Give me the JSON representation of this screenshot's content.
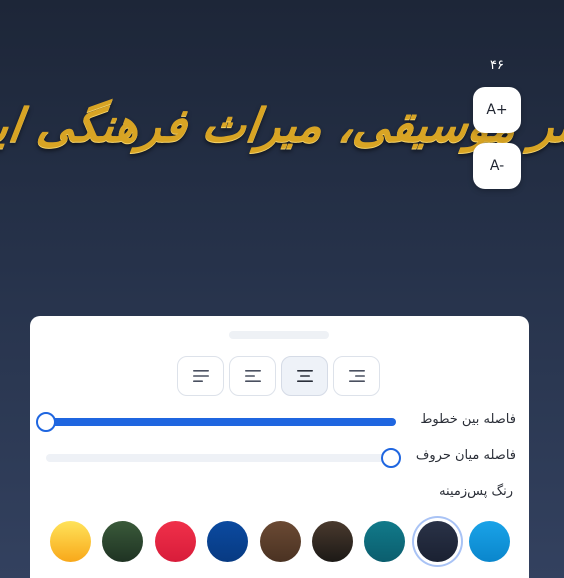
{
  "preview": {
    "text": "هنر موسیقی، میراث فرهنگی ایران",
    "color": "#d8a424"
  },
  "font_size": {
    "value": "۴۶",
    "increase_label": "A+",
    "decrease_label": "A-"
  },
  "panel": {
    "alignment": {
      "options": [
        {
          "name": "align-right",
          "icon": "align-right-icon"
        },
        {
          "name": "align-center",
          "icon": "align-center-icon"
        },
        {
          "name": "align-left",
          "icon": "align-left-icon"
        },
        {
          "name": "align-justify",
          "icon": "align-justify-icon"
        }
      ],
      "selected": "align-center"
    },
    "line_spacing": {
      "label": "فاصله بین خطوط",
      "level": 1.0
    },
    "letter_spacing": {
      "label": "فاصله میان حروف",
      "level": 0.0
    },
    "background": {
      "label": "رنگ پس‌زمینه",
      "swatches": [
        {
          "name": "sky-blue",
          "gradient": [
            "#1aa3e8",
            "#0a86cc"
          ]
        },
        {
          "name": "midnight",
          "gradient": [
            "#2a3247",
            "#1a2132"
          ],
          "selected": true
        },
        {
          "name": "teal",
          "gradient": [
            "#117a8a",
            "#0b5e6e"
          ]
        },
        {
          "name": "dark-brown",
          "gradient": [
            "#4a3a2e",
            "#1c1916"
          ]
        },
        {
          "name": "brown",
          "gradient": [
            "#6b4a34",
            "#4a3222"
          ]
        },
        {
          "name": "navy",
          "gradient": [
            "#0b4aa0",
            "#073a82"
          ]
        },
        {
          "name": "red",
          "gradient": [
            "#f0304a",
            "#d81c3a"
          ]
        },
        {
          "name": "forest",
          "gradient": [
            "#3a5a3a",
            "#1f3323"
          ]
        },
        {
          "name": "sunny",
          "gradient": [
            "#ffe35a",
            "#f8a81a"
          ]
        }
      ]
    },
    "accent": "#1f66e0"
  }
}
